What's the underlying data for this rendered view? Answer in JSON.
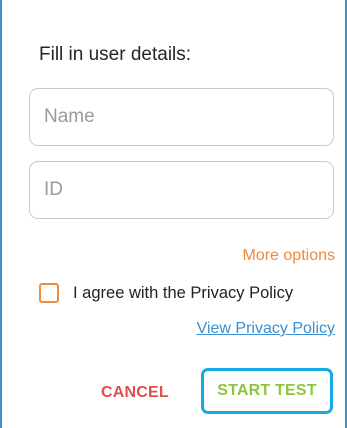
{
  "dialog": {
    "title": "Fill in user details:",
    "name_field": {
      "placeholder": "Name",
      "value": ""
    },
    "id_field": {
      "placeholder": "ID",
      "value": ""
    },
    "more_options_label": "More options",
    "privacy_checkbox": {
      "checked": false,
      "label": "I agree with the Privacy Policy"
    },
    "view_privacy_label": "View Privacy Policy",
    "buttons": {
      "cancel_label": "CANCEL",
      "start_label": "START TEST"
    }
  },
  "colors": {
    "accent_orange": "#f08a3c",
    "link_blue": "#3a8fd1",
    "cancel_red": "#e04e4e",
    "start_green": "#8cc63e",
    "focus_ring": "#16a9e3"
  }
}
